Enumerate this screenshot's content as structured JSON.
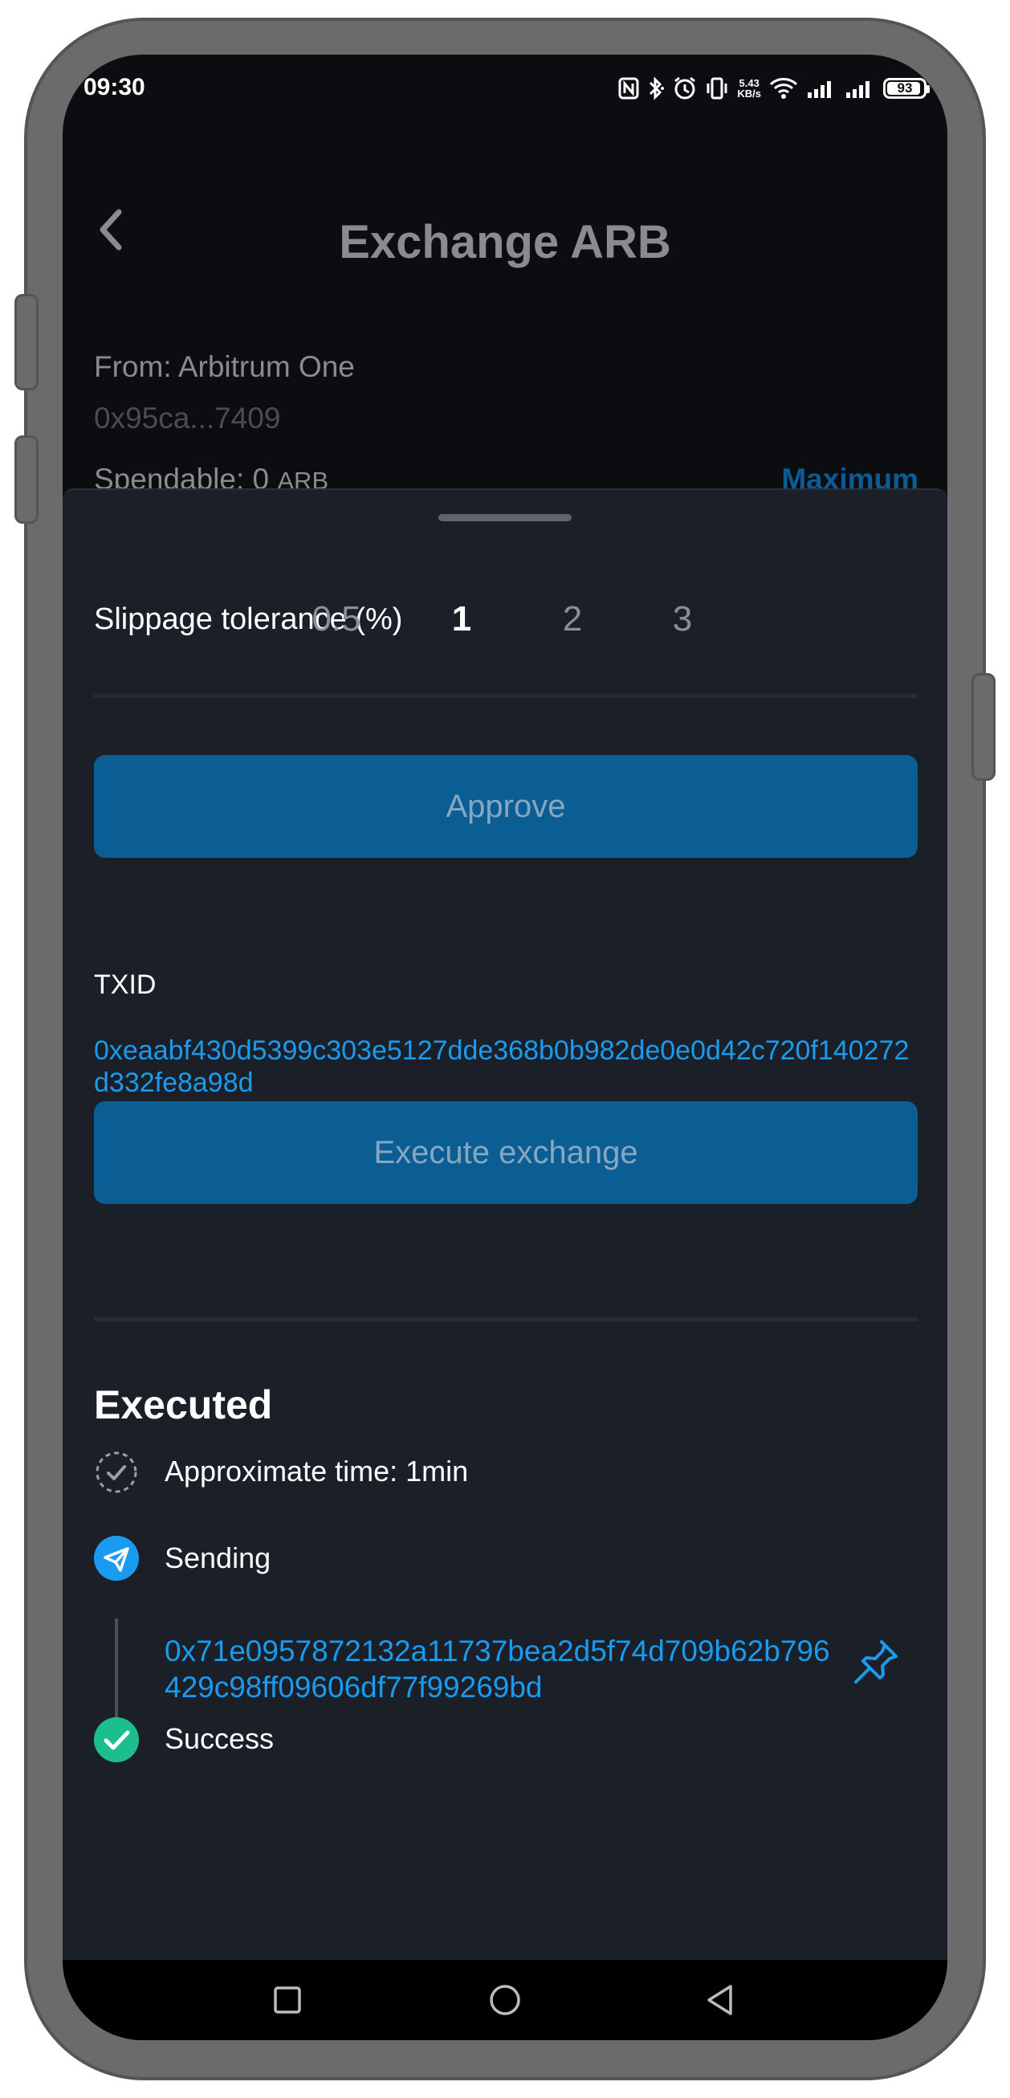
{
  "status_bar": {
    "time": "09:30",
    "net_speed_value": "5.43",
    "net_speed_unit": "KB/s",
    "battery": "93",
    "battery_level": 0.93
  },
  "header": {
    "title": "Exchange ARB",
    "from_label": "From: Arbitrum One",
    "from_address": "0x95ca...7409",
    "spendable_label": "Spendable: 0",
    "spendable_unit": "ARB",
    "maximum_label": "Maximum"
  },
  "slippage": {
    "label": "Slippage tolerance (%)",
    "options": [
      "0.5",
      "1",
      "2",
      "3"
    ],
    "selected": "1"
  },
  "approve_button": {
    "label": "Approve"
  },
  "txid": {
    "label": "TXID",
    "value": "0xeaabf430d5399c303e5127dde368b0b982de0e0d42c720f140272d332fe8a98d"
  },
  "execute_button": {
    "label": "Execute exchange"
  },
  "executed": {
    "title": "Executed",
    "approx_time": "Approximate time: 1min",
    "sending_label": "Sending",
    "sending_hash": "0x71e0957872132a11737bea2d5f74d709b62b796429c98ff09606df77f99269bd",
    "success_label": "Success"
  },
  "colors": {
    "accent": "#1a9bf0",
    "button_bg": "#0b5e93",
    "sheet_bg": "#1a1f28",
    "success": "#1cbf8c"
  },
  "icons": {
    "back": "chevron-left-icon",
    "clock": "clock-check-icon",
    "sending": "paper-plane-icon",
    "success": "check-circle-icon",
    "pin": "pin-icon",
    "nav_recent": "square-icon",
    "nav_home": "circle-icon",
    "nav_back": "triangle-back-icon"
  }
}
